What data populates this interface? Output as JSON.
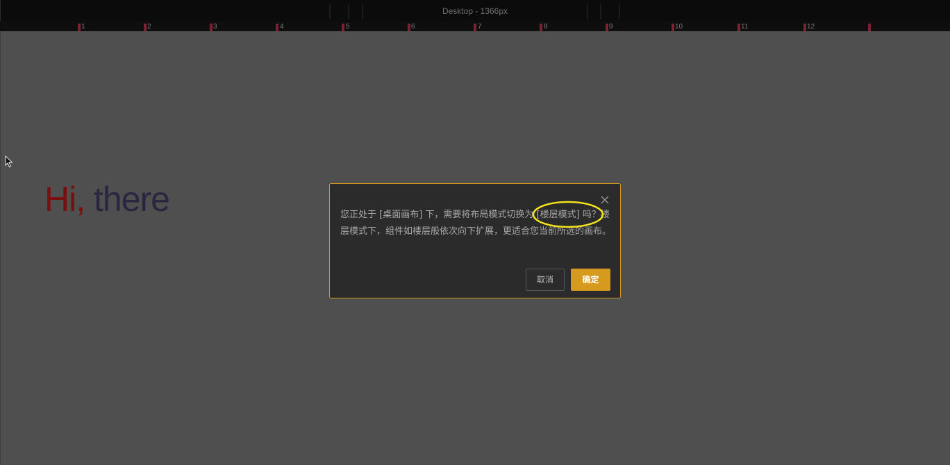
{
  "topbar": {
    "title": "Desktop - 1366px"
  },
  "ruler": {
    "labels": [
      "1",
      "2",
      "3",
      "4",
      "5",
      "6",
      "7",
      "8",
      "9",
      "10",
      "11",
      "12"
    ]
  },
  "canvas": {
    "hero_hi": "Hi,",
    "hero_there": "there"
  },
  "dialog": {
    "message": "您正处于 [桌面画布] 下，需要将布局模式切换为 [楼层模式] 吗？楼层模式下，组件如楼层般依次向下扩展，更适合您当前所选的画布。",
    "cancel_label": "取消",
    "ok_label": "确定",
    "close_icon": "close-icon"
  },
  "colors": {
    "accent": "#d69a1e",
    "highlight_ring": "#f2e21b",
    "hero_hi": "#7b0f0f",
    "hero_there": "#2a2540",
    "ruler_mark": "#7a2233"
  }
}
